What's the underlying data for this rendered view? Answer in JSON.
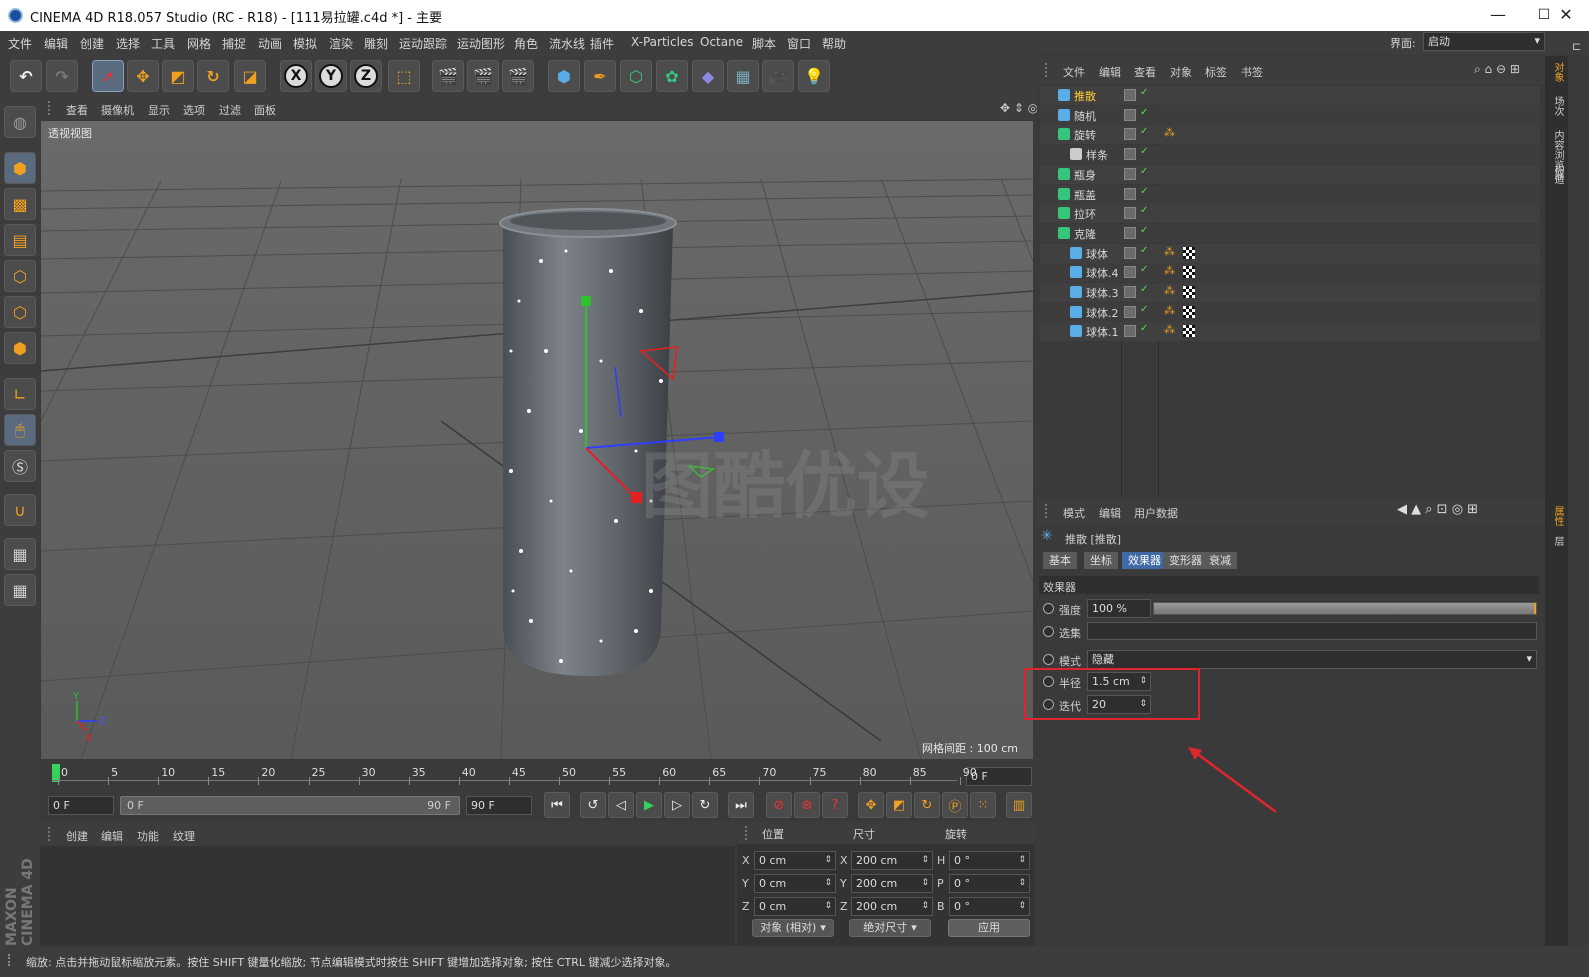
{
  "window": {
    "title": "CINEMA 4D R18.057 Studio (RC - R18) - [111易拉罐.c4d *] - 主要",
    "minimize": "—",
    "maximize": "☐",
    "close": "✕"
  },
  "menu": [
    "文件",
    "编辑",
    "创建",
    "选择",
    "工具",
    "网格",
    "捕捉",
    "动画",
    "模拟",
    "渲染",
    "雕刻",
    "运动跟踪",
    "运动图形",
    "角色",
    "流水线",
    "插件",
    "X-Particles",
    "Octane",
    "脚本",
    "窗口",
    "帮助"
  ],
  "layout": {
    "label": "界面:",
    "value": "启动"
  },
  "toolbar": {
    "x": "X",
    "y": "Y",
    "z": "Z"
  },
  "viewport": {
    "menu": [
      "查看",
      "摄像机",
      "显示",
      "选项",
      "过滤",
      "面板"
    ],
    "label": "透视视图",
    "grid_distance": "网格间距 : 100 cm",
    "watermark": "图酷优设",
    "axis_x": "X",
    "axis_y": "Y",
    "axis_z": "Z"
  },
  "timeline": {
    "ticks": [
      "0",
      "5",
      "10",
      "15",
      "20",
      "25",
      "30",
      "35",
      "40",
      "45",
      "50",
      "55",
      "60",
      "65",
      "70",
      "75",
      "80",
      "85",
      "90"
    ],
    "current": "0 F"
  },
  "playback": {
    "start": "0 F",
    "range_start": "0 F",
    "range_end": "90 F",
    "end": "90 F"
  },
  "materials": {
    "menu": [
      "创建",
      "编辑",
      "功能",
      "纹理"
    ]
  },
  "coords": {
    "headers": [
      "位置",
      "尺寸",
      "旋转"
    ],
    "rows": [
      {
        "a": "X",
        "pos": "0 cm",
        "b": "X",
        "size": "200 cm",
        "c": "H",
        "rot": "0 °"
      },
      {
        "a": "Y",
        "pos": "0 cm",
        "b": "Y",
        "size": "200 cm",
        "c": "P",
        "rot": "0 °"
      },
      {
        "a": "Z",
        "pos": "0 cm",
        "b": "Z",
        "size": "200 cm",
        "c": "B",
        "rot": "0 °"
      }
    ],
    "mode": "对象 (相对)",
    "size_mode": "绝对尺寸",
    "apply": "应用"
  },
  "status": "缩放: 点击并拖动鼠标缩放元素。按住 SHIFT 键量化缩放; 节点编辑模式时按住 SHIFT 键增加选择对象; 按住 CTRL 键减少选择对象。",
  "objects": {
    "menu": [
      "文件",
      "编辑",
      "查看",
      "对象",
      "标签",
      "书签"
    ],
    "items": [
      {
        "name": "推散",
        "indent": 0,
        "color": "#ffcc33"
      },
      {
        "name": "随机",
        "indent": 0,
        "color": "#d8d8d8"
      },
      {
        "name": "旋转",
        "indent": 0,
        "color": "#d8d8d8"
      },
      {
        "name": "样条",
        "indent": 1,
        "color": "#d8d8d8"
      },
      {
        "name": "瓶身",
        "indent": 0,
        "color": "#d8d8d8"
      },
      {
        "name": "瓶盖",
        "indent": 0,
        "color": "#d8d8d8"
      },
      {
        "name": "拉环",
        "indent": 0,
        "color": "#d8d8d8"
      },
      {
        "name": "克隆",
        "indent": 0,
        "color": "#d8d8d8"
      },
      {
        "name": "球体",
        "indent": 1,
        "color": "#d8d8d8"
      },
      {
        "name": "球体.4",
        "indent": 1,
        "color": "#d8d8d8"
      },
      {
        "name": "球体.3",
        "indent": 1,
        "color": "#d8d8d8"
      },
      {
        "name": "球体.2",
        "indent": 1,
        "color": "#d8d8d8"
      },
      {
        "name": "球体.1",
        "indent": 1,
        "color": "#d8d8d8"
      }
    ]
  },
  "attributes": {
    "menu": [
      "模式",
      "编辑",
      "用户数据"
    ],
    "object_title": "推散 [推散]",
    "tabs": [
      "基本",
      "坐标",
      "效果器",
      "变形器",
      "衰减"
    ],
    "active_tab": "效果器",
    "section": "效果器",
    "strength_label": "强度",
    "strength_value": "100 %",
    "strength": 1.0,
    "selection_label": "选集",
    "mode_label": "模式",
    "mode_value": "隐藏",
    "radius_label": "半径",
    "radius_value": "1.5 cm",
    "iterations_label": "迭代",
    "iterations_value": "20"
  },
  "side_tabs_top": [
    "对象",
    "场次",
    "内容浏览器",
    "构造"
  ],
  "side_tabs_bottom": [
    "属性",
    "层"
  ],
  "branding": "MAXON CINEMA 4D"
}
